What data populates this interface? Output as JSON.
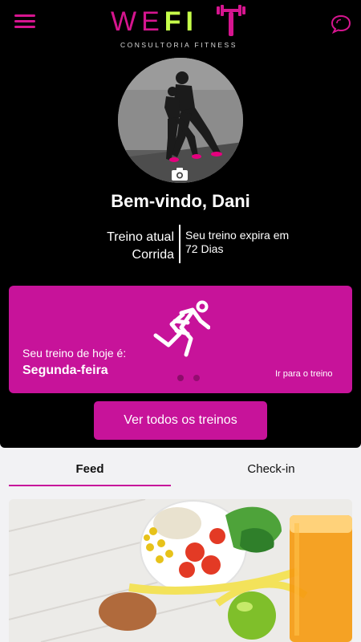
{
  "header": {
    "logo_main_prefix": "WE",
    "logo_main_highlight": "FI",
    "logo_sub": "CONSULTORIA FITNESS",
    "menu_icon": "hamburger-icon",
    "chat_icon": "chat-bubble-icon"
  },
  "profile": {
    "camera_icon": "camera-icon",
    "welcome": "Bem-vindo, Dani",
    "plan_label": "Treino atual",
    "plan_name": "Corrida",
    "expiry_text": "Seu treino expira em",
    "expiry_days": "72 Dias"
  },
  "today_card": {
    "icon": "runner-icon",
    "label": "Seu treino de hoje é:",
    "day": "Segunda-feira",
    "link": "Ir para o treino",
    "carousel": {
      "total": 2,
      "active": 0
    }
  },
  "all_workouts_button": "Ver todos os treinos",
  "tabs": [
    {
      "label": "Feed",
      "active": true
    },
    {
      "label": "Check-in",
      "active": false
    }
  ],
  "colors": {
    "brand_pink": "#c7139a",
    "logo_pink": "#d6158f",
    "logo_green": "#c6ff4a",
    "background_dark": "#000000",
    "background_light": "#f2f2f4"
  }
}
